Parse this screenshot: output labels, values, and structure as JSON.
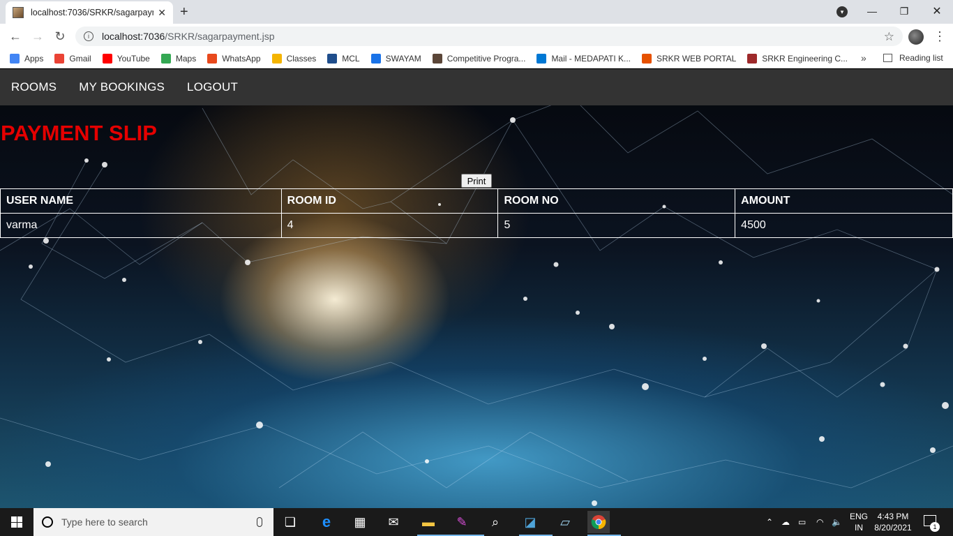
{
  "browser": {
    "tab_title": "localhost:7036/SRKR/sagarpayment.jsp",
    "tab_close": "✕",
    "new_tab": "+",
    "url_host": "localhost:7036",
    "url_path": "/SRKR/sagarpayment.jsp",
    "bookmarks": [
      {
        "label": "Apps",
        "icon": "apps-grid-icon",
        "color": "#4285f4"
      },
      {
        "label": "Gmail",
        "icon": "gmail-icon",
        "color": "#ea4335"
      },
      {
        "label": "YouTube",
        "icon": "youtube-icon",
        "color": "#ff0000"
      },
      {
        "label": "Maps",
        "icon": "maps-pin-icon",
        "color": "#34a853"
      },
      {
        "label": "WhatsApp",
        "icon": "whatsapp-icon",
        "color": "#e8491d"
      },
      {
        "label": "Classes",
        "icon": "classroom-icon",
        "color": "#f4b400"
      },
      {
        "label": "MCL",
        "icon": "mcl-icon",
        "color": "#1f4e8c"
      },
      {
        "label": "SWAYAM",
        "icon": "swayam-icon",
        "color": "#1a73e8"
      },
      {
        "label": "Competitive Progra...",
        "icon": "cc-icon",
        "color": "#5b4638"
      },
      {
        "label": "Mail - MEDAPATI K...",
        "icon": "outlook-icon",
        "color": "#0078d4"
      },
      {
        "label": "SRKR WEB PORTAL",
        "icon": "srkr-portal-icon",
        "color": "#e65100"
      },
      {
        "label": "SRKR Engineering C...",
        "icon": "srkr-college-icon",
        "color": "#9e2a2b"
      }
    ],
    "bookmarks_more": "»",
    "reading_list": "Reading list"
  },
  "nav": {
    "rooms": "ROOMS",
    "my_bookings": "MY BOOKINGS",
    "logout": "LOGOUT"
  },
  "page": {
    "title": "PAYMENT SLIP",
    "print_label": "Print",
    "title_color": "#e50000"
  },
  "slip_table": {
    "headers": [
      "USER NAME",
      "ROOM ID",
      "ROOM NO",
      "AMOUNT"
    ],
    "rows": [
      [
        "varma",
        "4",
        "5",
        "4500"
      ]
    ]
  },
  "taskbar": {
    "search_placeholder": "Type here to search",
    "lang_top": "ENG",
    "lang_bottom": "IN",
    "time": "4:43 PM",
    "date": "8/20/2021",
    "notification_count": "1"
  }
}
